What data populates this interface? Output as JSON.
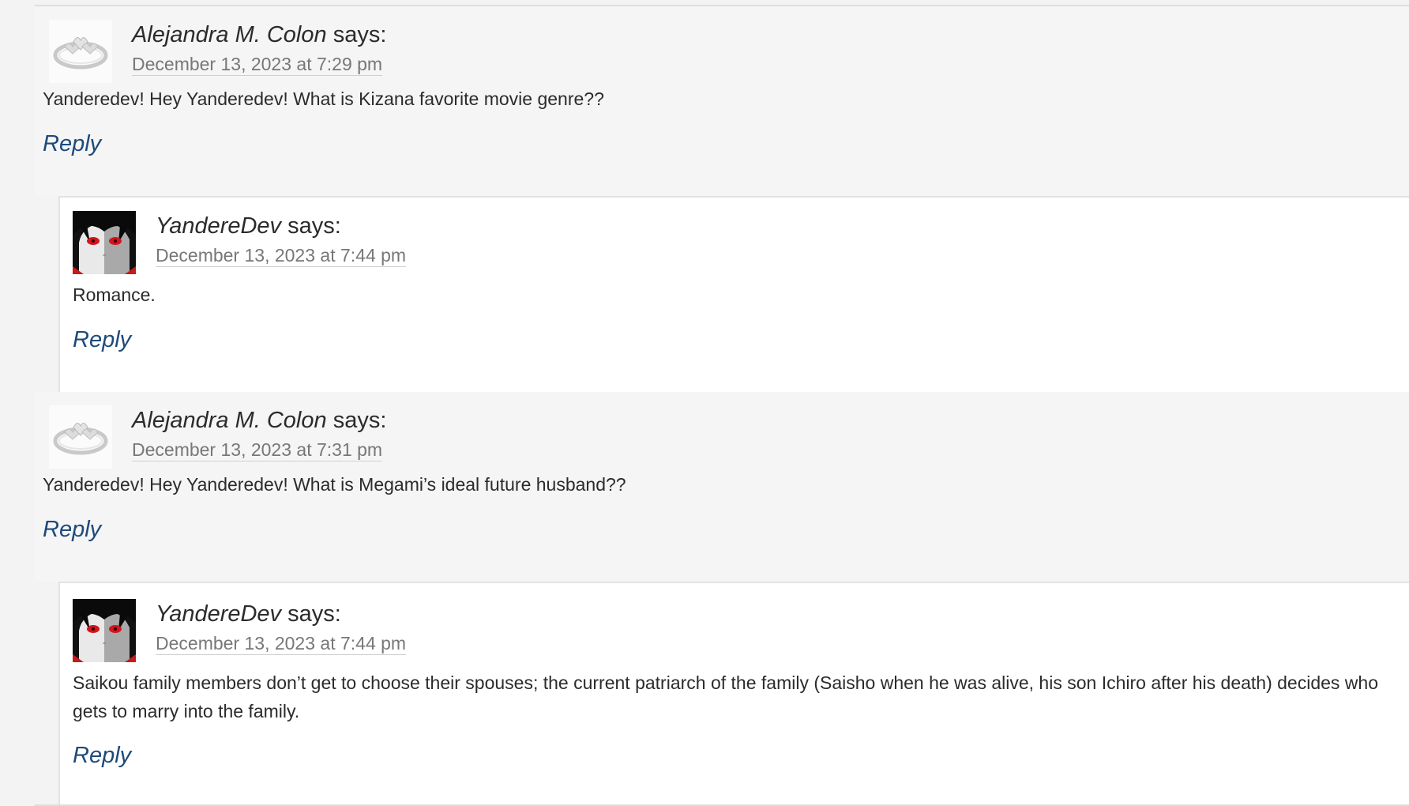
{
  "comments": [
    {
      "author": "Alejandra M. Colon",
      "says": "says:",
      "date": "December 13, 2023 at 7:29 pm",
      "text": "Yanderedev! Hey Yanderedev! What is Kizana favorite movie genre??",
      "reply_label": "Reply",
      "avatar": "ring-avatar"
    },
    {
      "author": "YandereDev",
      "says": "says:",
      "date": "December 13, 2023 at 7:44 pm",
      "text": "Romance.",
      "reply_label": "Reply",
      "avatar": "anime-face-avatar"
    },
    {
      "author": "Alejandra M. Colon",
      "says": "says:",
      "date": "December 13, 2023 at 7:31 pm",
      "text": "Yanderedev! Hey Yanderedev! What is Megami’s ideal future husband??",
      "reply_label": "Reply",
      "avatar": "ring-avatar"
    },
    {
      "author": "YandereDev",
      "says": "says:",
      "date": "December 13, 2023 at 7:44 pm",
      "text": "Saikou family members don’t get to choose their spouses; the current patriarch of the family (Saisho when he was alive, his son Ichiro after his death) decides who gets to marry into the family.",
      "reply_label": "Reply",
      "avatar": "anime-face-avatar"
    }
  ],
  "colors": {
    "link": "#1e4a7a",
    "date": "#777777",
    "text": "#2b2b2b",
    "parent_bg": "#f5f5f5",
    "child_bg": "#ffffff"
  }
}
